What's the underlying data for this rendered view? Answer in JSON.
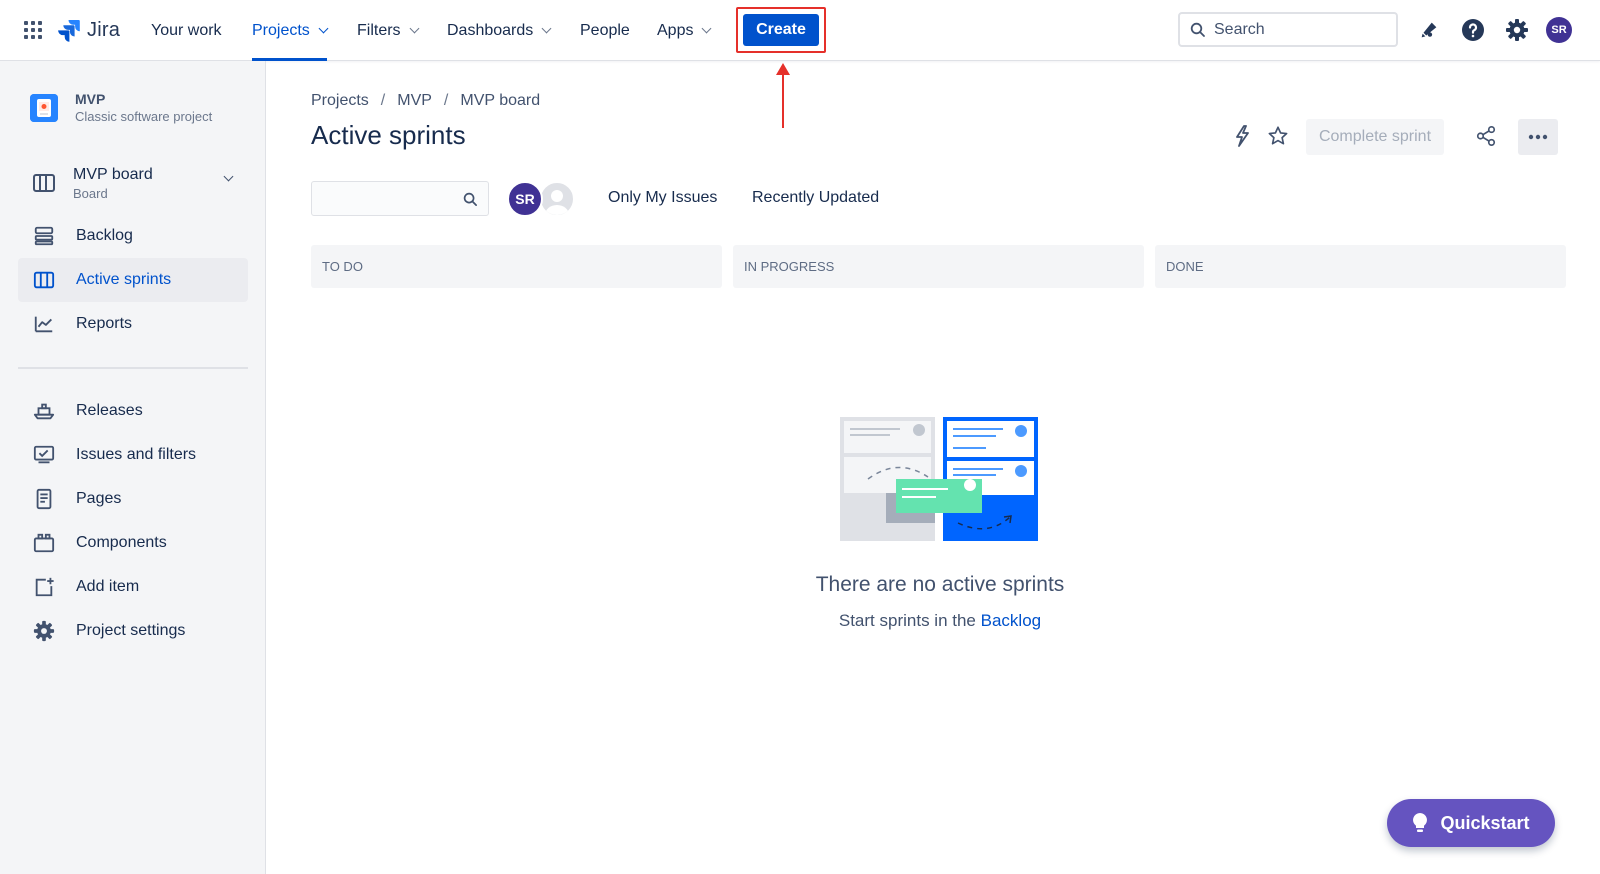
{
  "topnav": {
    "logo": "Jira",
    "items": [
      {
        "label": "Your work"
      },
      {
        "label": "Projects"
      },
      {
        "label": "Filters"
      },
      {
        "label": "Dashboards"
      },
      {
        "label": "People"
      },
      {
        "label": "Apps"
      }
    ],
    "create_label": "Create",
    "search_placeholder": "Search",
    "user_initials": "SR",
    "accent": "#0052CC",
    "annotation_color": "#E5302A"
  },
  "sidebar": {
    "project_name": "MVP",
    "project_type": "Classic software project",
    "board_name": "MVP board",
    "board_type": "Board",
    "items": [
      {
        "label": "Backlog",
        "icon": "backlog-icon"
      },
      {
        "label": "Active sprints",
        "icon": "board-columns-icon"
      },
      {
        "label": "Reports",
        "icon": "chart-line-icon"
      }
    ],
    "secondary_items": [
      {
        "label": "Releases",
        "icon": "ship-icon"
      },
      {
        "label": "Issues and filters",
        "icon": "issues-icon"
      },
      {
        "label": "Pages",
        "icon": "page-icon"
      },
      {
        "label": "Components",
        "icon": "component-icon"
      },
      {
        "label": "Add item",
        "icon": "add-item-icon"
      },
      {
        "label": "Project settings",
        "icon": "gear-icon"
      }
    ]
  },
  "main": {
    "breadcrumb": [
      "Projects",
      "MVP",
      "MVP board"
    ],
    "title": "Active sprints",
    "complete_sprint_label": "Complete sprint",
    "avatar_initials": "SR",
    "quick_filters": [
      "Only My Issues",
      "Recently Updated"
    ],
    "columns": [
      "TO DO",
      "IN PROGRESS",
      "DONE"
    ],
    "empty_title": "There are no active sprints",
    "empty_sub": "Start sprints in the",
    "empty_link": "Backlog"
  },
  "quickstart_label": "Quickstart"
}
